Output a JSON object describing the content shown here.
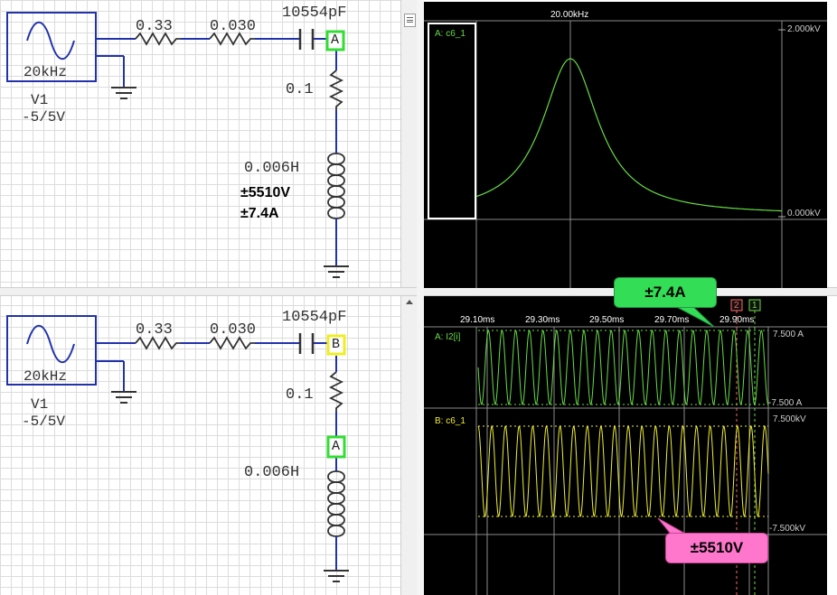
{
  "top_circuit": {
    "source_freq": "20kHz",
    "source_name": "V1",
    "source_range": "-5/5V",
    "r1": "0.33",
    "r2": "0.030",
    "cap": "10554pF",
    "probe": "A",
    "r3": "0.1",
    "inductor": "0.006H",
    "voltage_note": "±5510V",
    "current_note": "±7.4A"
  },
  "bottom_circuit": {
    "source_freq": "20kHz",
    "source_name": "V1",
    "source_range": "-5/5V",
    "r1": "0.33",
    "r2": "0.030",
    "cap": "10554pF",
    "probe_b": "B",
    "r3": "0.1",
    "probe_a": "A",
    "inductor": "0.006H"
  },
  "scope_top": {
    "freq_label": "20.00kHz",
    "channel": "A: c6_1",
    "top_value": "2.000kV",
    "bottom_value": "0.000kV"
  },
  "scope_bottom": {
    "time_labels": [
      "29.10ms",
      "29.30ms",
      "29.50ms",
      "29.70ms",
      "29.90ms"
    ],
    "cursor_2": "2",
    "cursor_1": "1",
    "channel_a": "A: I2[i]",
    "a_top": "7.500 A",
    "a_bottom": "-7.500 A",
    "channel_b": "B: c6_1",
    "b_top": "7.500kV",
    "b_bottom": "-7.500kV"
  },
  "callouts": {
    "current": "±7.4A",
    "voltage": "±5510V"
  },
  "colors": {
    "trace_green": "#66dd44",
    "trace_yellow": "#eeee33",
    "wire_blue": "#2233aa",
    "callout_green": "#33dd55",
    "callout_pink": "#ff77cc"
  },
  "icons": {
    "scroll_grip": "three-line-grip",
    "scroll_up": "triangle-up"
  }
}
